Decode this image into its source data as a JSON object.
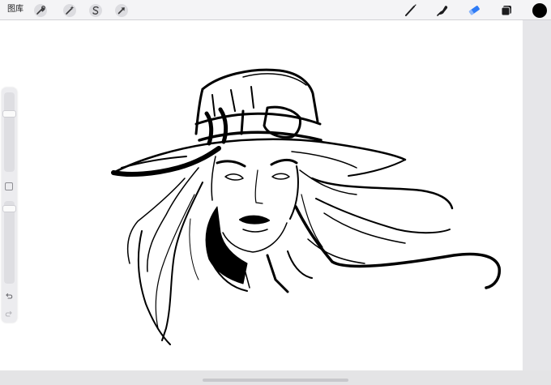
{
  "toolbar": {
    "gallery_label": "图库",
    "left_icons": [
      "wrench-icon",
      "magic-wand-icon",
      "selection-s-icon",
      "transform-arrow-icon"
    ],
    "right_icons": [
      "brush-icon",
      "smudge-icon",
      "eraser-icon",
      "layers-icon"
    ],
    "active_tool": "eraser",
    "accent_color": "#2f7cf6",
    "current_color": "#000000"
  },
  "sidebar": {
    "brush_size_level": 0.85,
    "opacity_level": 0.95,
    "undo_icon": "undo-icon",
    "redo_icon": "redo-icon"
  }
}
